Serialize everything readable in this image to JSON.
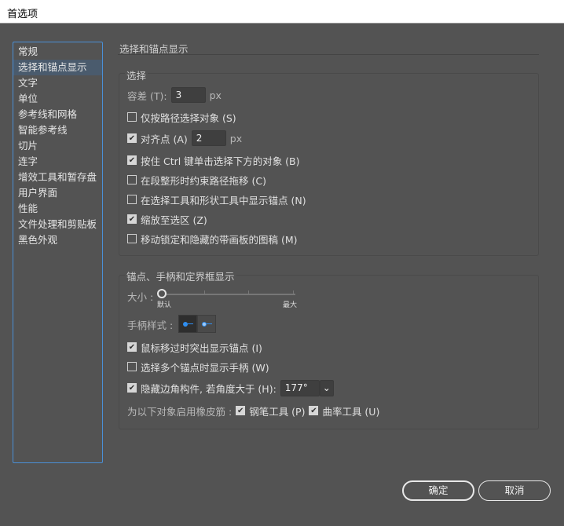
{
  "window": {
    "title": "首选项"
  },
  "sidebar": {
    "items": [
      {
        "label": "常规"
      },
      {
        "label": "选择和锚点显示"
      },
      {
        "label": "文字"
      },
      {
        "label": "单位"
      },
      {
        "label": "参考线和网格"
      },
      {
        "label": "智能参考线"
      },
      {
        "label": "切片"
      },
      {
        "label": "连字"
      },
      {
        "label": "增效工具和暂存盘"
      },
      {
        "label": "用户界面"
      },
      {
        "label": "性能"
      },
      {
        "label": "文件处理和剪贴板"
      },
      {
        "label": "黑色外观"
      }
    ],
    "selected_index": 1
  },
  "main": {
    "heading": "选择和锚点显示",
    "selection": {
      "label": "选择",
      "tolerance_label": "容差 (T):",
      "tolerance_value": "3",
      "tolerance_unit": "px",
      "options": [
        {
          "label": "仅按路径选择对象 (S)",
          "checked": false
        },
        {
          "label": "对齐点 (A)",
          "checked": true,
          "value": "2",
          "unit": "px"
        },
        {
          "label": "按住 Ctrl 键单击选择下方的对象 (B)",
          "checked": true
        },
        {
          "label": "在段整形时约束路径拖移 (C)",
          "checked": false
        },
        {
          "label": "在选择工具和形状工具中显示锚点 (N)",
          "checked": false
        },
        {
          "label": "缩放至选区 (Z)",
          "checked": true
        },
        {
          "label": "移动锁定和隐藏的带画板的图稿 (M)",
          "checked": false
        }
      ]
    },
    "anchor": {
      "label": "锚点、手柄和定界框显示",
      "size_label": "大小 :",
      "size_min": "默认",
      "size_max": "最大",
      "size_value": 0,
      "handle_style_label": "手柄样式 :",
      "handle_style_selected": 0,
      "options": [
        {
          "label": "鼠标移过时突出显示锚点 (I)",
          "checked": true
        },
        {
          "label": "选择多个锚点时显示手柄 (W)",
          "checked": false
        },
        {
          "label": "隐藏边角构件, 若角度大于 (H):",
          "checked": true,
          "value": "177°"
        }
      ],
      "rubber_band_label": "为以下对象启用橡皮筋 :",
      "pen_label": "钢笔工具 (P)",
      "pen_checked": true,
      "curvature_label": "曲率工具 (U)",
      "curvature_checked": true
    }
  },
  "buttons": {
    "ok": "确定",
    "cancel": "取消"
  },
  "colors": {
    "accent": "#4a8fd6",
    "handle_blue": "#2f8ef0"
  }
}
